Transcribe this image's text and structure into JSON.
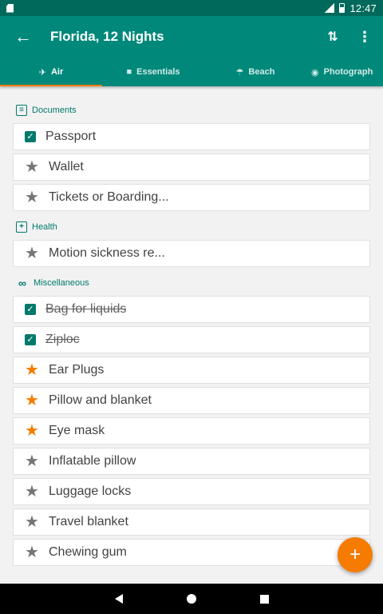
{
  "status_bar": {
    "time": "12:47"
  },
  "app_bar": {
    "title": "Florida, 12 Nights",
    "back_icon": "arrow-left-icon",
    "sort_icon": "sort-arrows-icon",
    "more_icon": "more-vertical-icon"
  },
  "tabs": [
    {
      "label": "Air",
      "icon": "airplane-icon",
      "active": true
    },
    {
      "label": "Essentials",
      "icon": "bag-icon"
    },
    {
      "label": "Beach",
      "icon": "umbrella-icon"
    },
    {
      "label": "Photograph",
      "icon": "camera-icon"
    }
  ],
  "sections": {
    "documents": {
      "title": "Documents",
      "items": [
        "Passport",
        "Wallet",
        "Tickets or Boarding..."
      ]
    },
    "health": {
      "title": "Health",
      "items": [
        "Motion sickness re..."
      ]
    },
    "misc": {
      "title": "Miscellaneous",
      "items": [
        "Bag for liquids",
        "Ziploc",
        "Ear Plugs",
        "Pillow and blanket",
        "Eye mask",
        "Inflatable pillow",
        "Luggage locks",
        "Travel blanket",
        "Chewing gum"
      ]
    }
  },
  "fab": {
    "label": "+",
    "icon": "add-icon"
  },
  "colors": {
    "primary": "#00897b",
    "primary_dark": "#00695c",
    "accent": "#f57c00"
  }
}
